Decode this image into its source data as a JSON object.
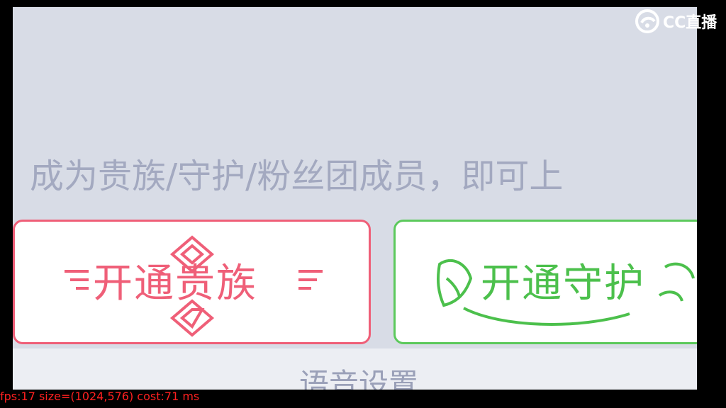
{
  "hint_text": "成为贵族/守护/粉丝团成员，即可上",
  "buttons": {
    "noble": {
      "label": "开通贵族",
      "color": "#ef5f78"
    },
    "guard": {
      "label": "开通守护",
      "color": "#4cc04c"
    }
  },
  "section_label": "语音设置",
  "watermark": {
    "text": "CC直播",
    "icon": "cc-logo-icon"
  },
  "stats_overlay": "fps:17 size=(1024,576) cost:71 ms"
}
